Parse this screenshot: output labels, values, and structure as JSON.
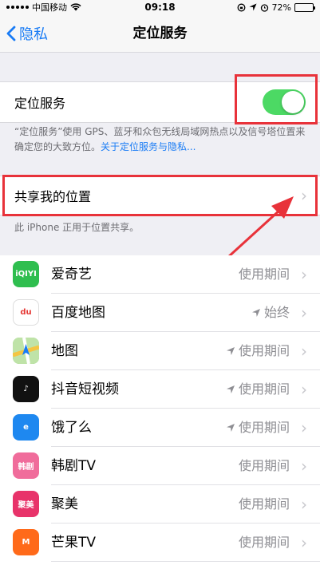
{
  "status_bar": {
    "carrier": "中国移动",
    "time": "09:18",
    "battery": "72%",
    "battery_level": 0.72
  },
  "nav": {
    "back_label": "隐私",
    "title": "定位服务"
  },
  "location_services": {
    "label": "定位服务",
    "enabled": true,
    "description": "“定位服务”使用 GPS、蓝牙和众包无线局域网热点以及信号塔位置来确定您的大致方位。",
    "link_text": "关于定位服务与隐私..."
  },
  "share_location": {
    "label": "共享我的位置",
    "footnote": "此 iPhone 正用于位置共享。"
  },
  "apps": [
    {
      "name": "爱奇艺",
      "status": "使用期间",
      "arrow": "none",
      "icon": "iqiyi-icon",
      "color": "#2fbe4f",
      "glyph": "iQIYI"
    },
    {
      "name": "百度地图",
      "status": "始终",
      "arrow": "solid",
      "icon": "baidu-map-icon",
      "color": "#ffffff",
      "glyph": "du"
    },
    {
      "name": "地图",
      "status": "使用期间",
      "arrow": "outline",
      "icon": "maps-icon",
      "color": "#7ec96a",
      "glyph": ""
    },
    {
      "name": "抖音短视频",
      "status": "使用期间",
      "arrow": "outline",
      "icon": "douyin-icon",
      "color": "#111111",
      "glyph": "♪"
    },
    {
      "name": "饿了么",
      "status": "使用期间",
      "arrow": "outline",
      "icon": "eleme-icon",
      "color": "#1e88f0",
      "glyph": "e"
    },
    {
      "name": "韩剧TV",
      "status": "使用期间",
      "arrow": "none",
      "icon": "hanjutv-icon",
      "color": "#f06c9b",
      "glyph": "韩剧"
    },
    {
      "name": "聚美",
      "status": "使用期间",
      "arrow": "none",
      "icon": "jumei-icon",
      "color": "#e8336a",
      "glyph": "聚美"
    },
    {
      "name": "芒果TV",
      "status": "使用期间",
      "arrow": "none",
      "icon": "mangotv-icon",
      "color": "#ff6a1a",
      "glyph": "M"
    }
  ],
  "colors": {
    "accent_blue": "#1a7cf5",
    "toggle_green": "#4cd964",
    "highlight_red": "#e8323a"
  }
}
